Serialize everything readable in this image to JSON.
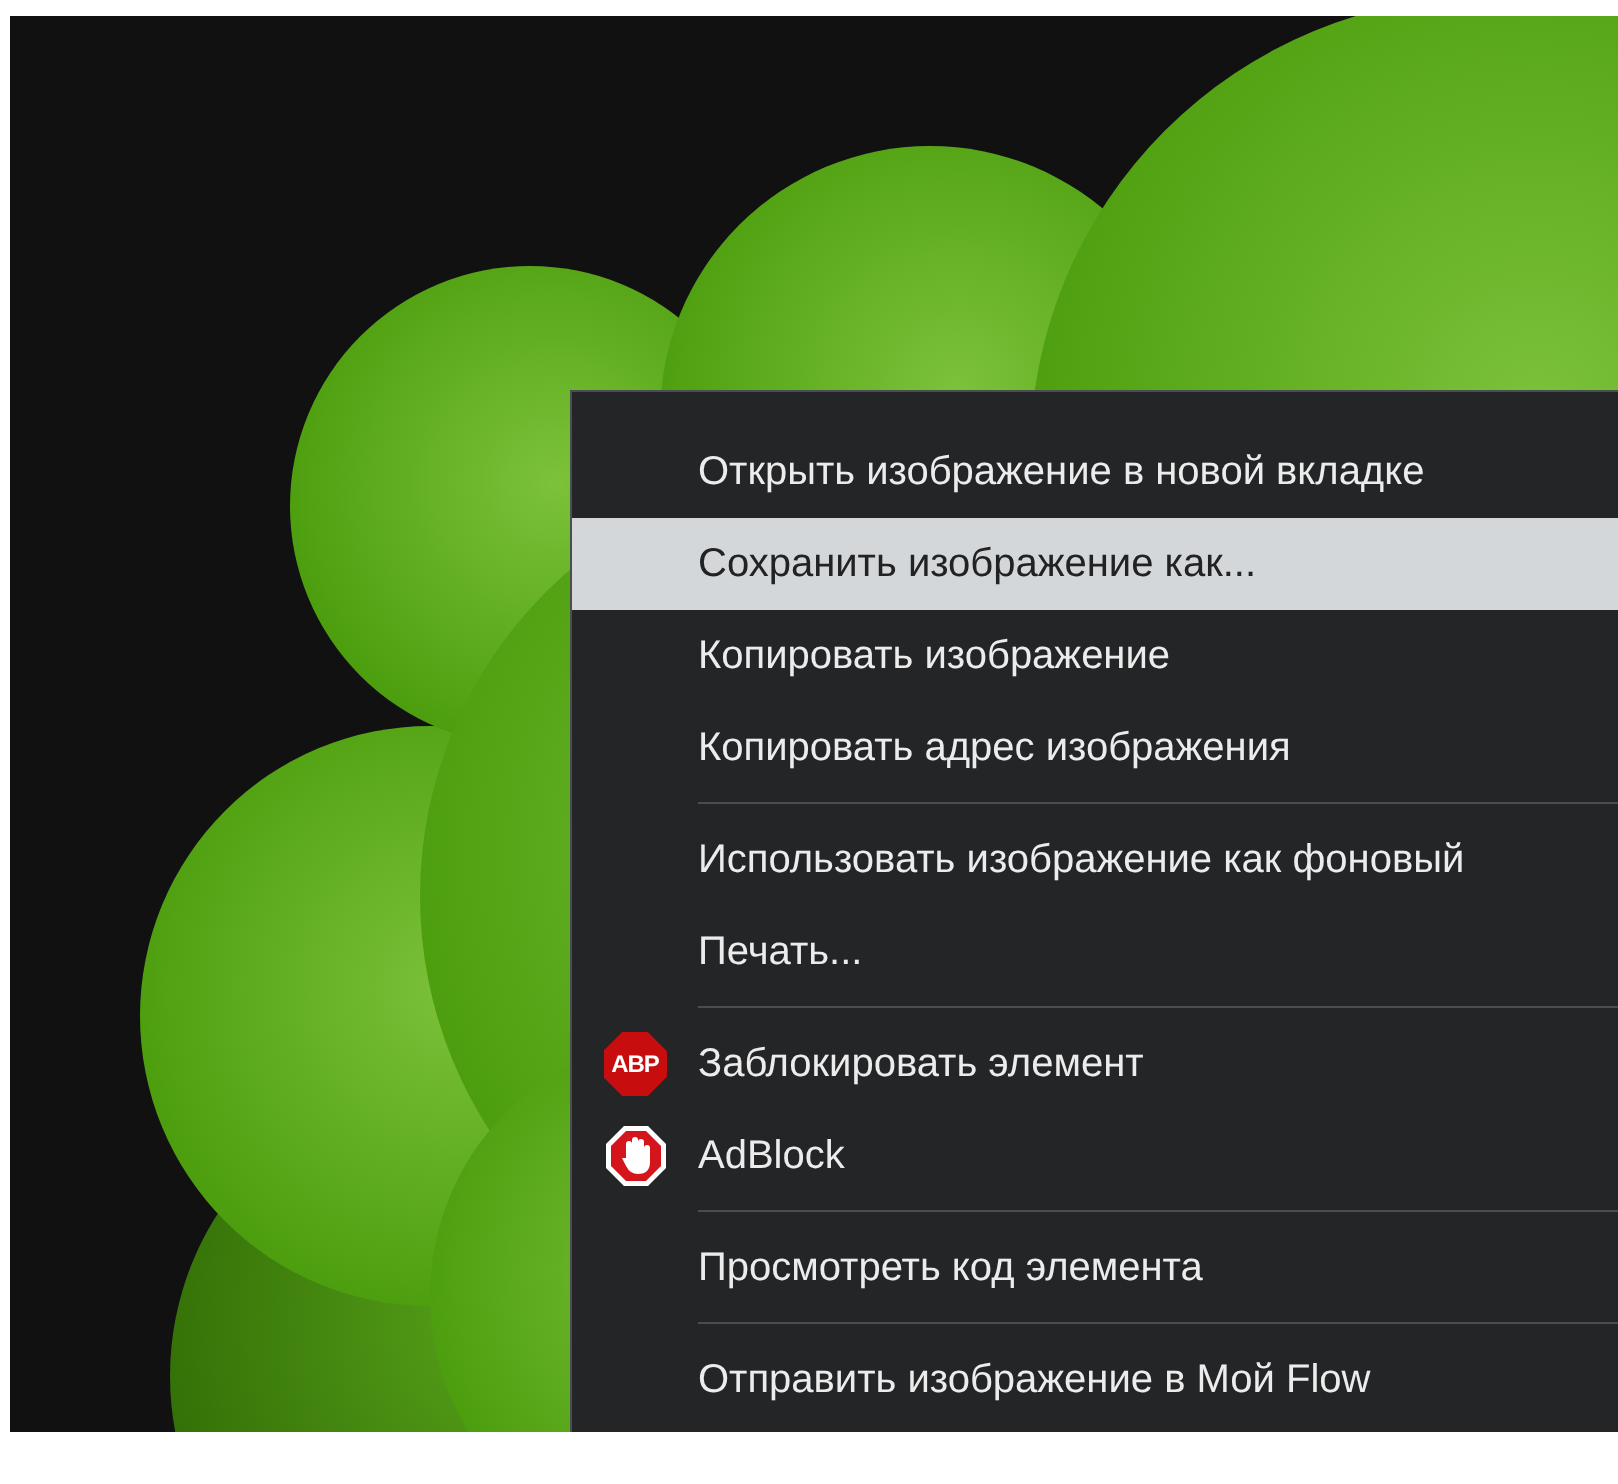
{
  "context_menu": {
    "items": [
      {
        "kind": "item",
        "label": "Открыть изображение в новой вкладке",
        "selected": false
      },
      {
        "kind": "item",
        "label": "Сохранить изображение как...",
        "selected": true
      },
      {
        "kind": "item",
        "label": "Копировать изображение",
        "selected": false
      },
      {
        "kind": "item",
        "label": "Копировать адрес изображения",
        "selected": false
      },
      {
        "kind": "separator"
      },
      {
        "kind": "item",
        "label": "Использовать изображение как фоновый",
        "selected": false
      },
      {
        "kind": "item",
        "label": "Печать...",
        "selected": false
      },
      {
        "kind": "separator"
      },
      {
        "kind": "abp",
        "label": "Заблокировать элемент",
        "icon_text": "ABP",
        "selected": false
      },
      {
        "kind": "adblock",
        "label": "AdBlock",
        "selected": false
      },
      {
        "kind": "separator"
      },
      {
        "kind": "item",
        "label": "Просмотреть код элемента",
        "selected": false
      },
      {
        "kind": "separator"
      },
      {
        "kind": "item",
        "label": "Отправить изображение в Мой Flow",
        "selected": false
      }
    ]
  }
}
